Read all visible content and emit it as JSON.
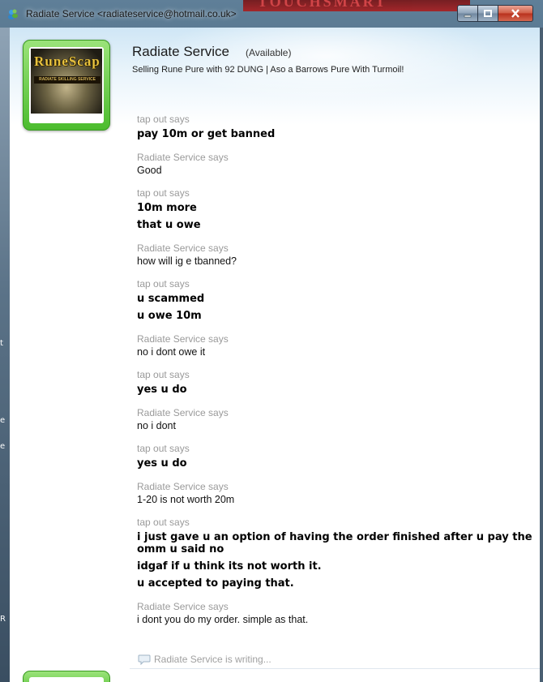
{
  "window": {
    "title": "Radiate Service <radiateservice@hotmail.co.uk>",
    "background_banner": "TOUCHSMART"
  },
  "contact": {
    "name": "Radiate Service",
    "status": "(Available)",
    "personal_message": "Selling Rune Pure with 92 DUNG | Aso a Barrows Pure With Turmoil!",
    "avatar": {
      "logo_text": "RuneScap",
      "sub_text": "RADIATE SKILLING SERVICE"
    }
  },
  "messages": [
    {
      "sender": "tap out says",
      "lines": [
        "pay 10m or get banned"
      ],
      "style": "bold"
    },
    {
      "sender": "Radiate Service says",
      "lines": [
        "Good"
      ],
      "style": "normal"
    },
    {
      "sender": "tap out says",
      "lines": [
        "10m more",
        "that u owe"
      ],
      "style": "bold"
    },
    {
      "sender": "Radiate Service says",
      "lines": [
        "how will ig e tbanned?"
      ],
      "style": "normal"
    },
    {
      "sender": "tap out says",
      "lines": [
        "u scammed",
        "u owe 10m"
      ],
      "style": "bold"
    },
    {
      "sender": "Radiate Service says",
      "lines": [
        "no i dont owe it"
      ],
      "style": "normal"
    },
    {
      "sender": "tap out says",
      "lines": [
        "yes u do"
      ],
      "style": "bold"
    },
    {
      "sender": "Radiate Service says",
      "lines": [
        "no i dont"
      ],
      "style": "normal"
    },
    {
      "sender": "tap out says",
      "lines": [
        "yes u do"
      ],
      "style": "bold"
    },
    {
      "sender": "Radiate Service says",
      "lines": [
        "1-20 is not worth 20m"
      ],
      "style": "normal"
    },
    {
      "sender": "tap out says",
      "lines": [
        "i just gave u an option of having the order finished after u pay the omm u said no",
        "idgaf if u think its not worth it.",
        "u accepted to paying that."
      ],
      "style": "bold"
    },
    {
      "sender": "Radiate Service says",
      "lines": [
        "i dont you do my order. simple as that."
      ],
      "style": "normal"
    }
  ],
  "typing_indicator": "Radiate Service is writing...",
  "left_strip_glyphs": [
    "t",
    "e",
    "e",
    "R"
  ],
  "colors": {
    "avatar_frame": "#4cbc2e",
    "sender_gray": "#9a9a9a",
    "close_red": "#c23a22"
  }
}
